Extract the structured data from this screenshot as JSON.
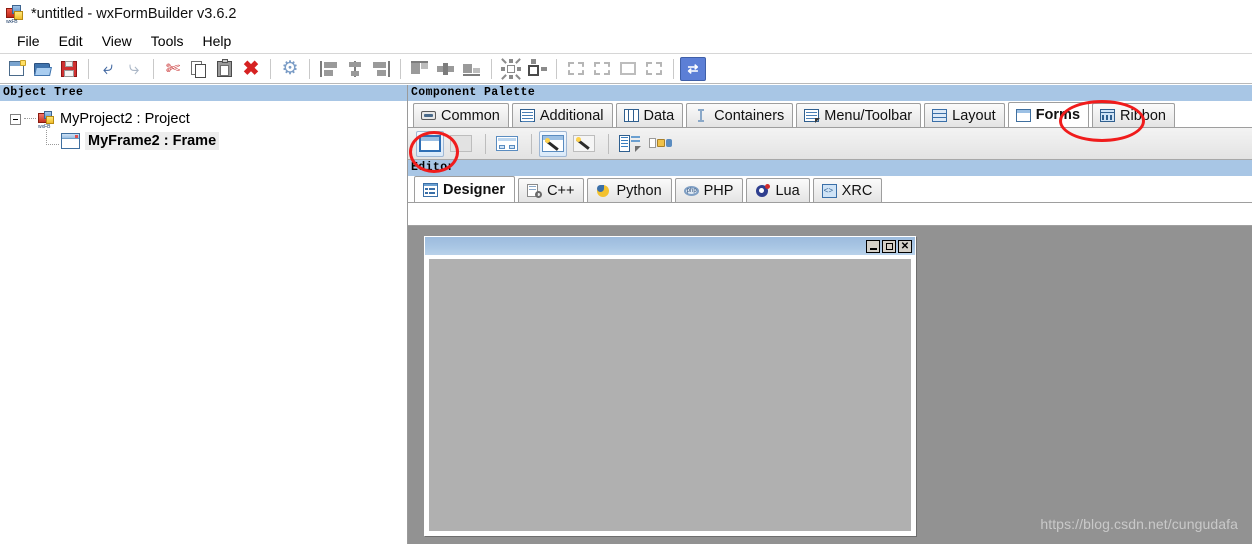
{
  "window": {
    "title": "*untitled - wxFormBuilder v3.6.2",
    "app_icon": "wxformbuilder-icon"
  },
  "menubar": {
    "items": [
      {
        "label": "File"
      },
      {
        "label": "Edit"
      },
      {
        "label": "View"
      },
      {
        "label": "Tools"
      },
      {
        "label": "Help"
      }
    ]
  },
  "toolbar": {
    "buttons": [
      {
        "name": "new-project",
        "icon": "new-file-icon"
      },
      {
        "name": "open-project",
        "icon": "open-folder-icon"
      },
      {
        "name": "save-project",
        "icon": "save-floppy-icon"
      },
      {
        "name": "undo",
        "icon": "undo-arrow-icon"
      },
      {
        "name": "redo",
        "icon": "redo-arrow-icon"
      },
      {
        "name": "cut",
        "icon": "scissors-icon"
      },
      {
        "name": "copy",
        "icon": "copy-icon"
      },
      {
        "name": "paste",
        "icon": "paste-icon"
      },
      {
        "name": "delete",
        "icon": "delete-x-icon"
      },
      {
        "name": "generate-code",
        "icon": "gear-icon"
      },
      {
        "name": "align-left",
        "icon": "align-left-icon"
      },
      {
        "name": "align-center-h",
        "icon": "align-center-icon"
      },
      {
        "name": "align-right",
        "icon": "align-right-icon"
      },
      {
        "name": "align-top",
        "icon": "align-top-icon"
      },
      {
        "name": "align-center-v",
        "icon": "align-middle-icon"
      },
      {
        "name": "align-bottom",
        "icon": "align-bottom-icon"
      },
      {
        "name": "expand",
        "icon": "expand-arrows-icon"
      },
      {
        "name": "stretch",
        "icon": "stretch-icon"
      },
      {
        "name": "border-left",
        "icon": "border-left-icon"
      },
      {
        "name": "border-right",
        "icon": "border-right-icon"
      },
      {
        "name": "border-top",
        "icon": "border-top-icon"
      },
      {
        "name": "border-bottom",
        "icon": "border-bottom-icon"
      },
      {
        "name": "toggle-orientation",
        "icon": "swap-arrows-icon"
      }
    ]
  },
  "object_tree": {
    "caption": "Object Tree",
    "nodes": [
      {
        "label": "MyProject2 : Project",
        "icon": "project-icon",
        "level": 0,
        "expanded": true,
        "selected": false
      },
      {
        "label": "MyFrame2 : Frame",
        "icon": "frame-icon",
        "level": 1,
        "expanded": false,
        "selected": true
      }
    ]
  },
  "component_palette": {
    "caption": "Component Palette",
    "tabs": [
      {
        "label": "Common",
        "icon": "button-icon",
        "selected": false
      },
      {
        "label": "Additional",
        "icon": "list-icon",
        "selected": false
      },
      {
        "label": "Data",
        "icon": "grid-icon",
        "selected": false
      },
      {
        "label": "Containers",
        "icon": "container-icon",
        "selected": false
      },
      {
        "label": "Menu/Toolbar",
        "icon": "menu-icon",
        "selected": false
      },
      {
        "label": "Layout",
        "icon": "layout-icon",
        "selected": false
      },
      {
        "label": "Forms",
        "icon": "form-icon",
        "selected": true
      },
      {
        "label": "Ribbon",
        "icon": "ribbon-icon",
        "selected": false
      }
    ],
    "items": [
      {
        "name": "wx-frame",
        "icon": "frame-widget-icon",
        "selected": true
      },
      {
        "name": "wx-panel-form",
        "icon": "panel-widget-icon",
        "selected": false
      },
      {
        "name": "wx-dialog",
        "icon": "dialog-widget-icon",
        "selected": false
      },
      {
        "name": "wx-wizard",
        "icon": "wizard-icon",
        "selected": false
      },
      {
        "name": "wx-wizard-page",
        "icon": "wizard-page-icon",
        "selected": false
      },
      {
        "name": "wx-menu-bar-form",
        "icon": "menubar-form-icon",
        "selected": false
      },
      {
        "name": "wx-tool-bar-form",
        "icon": "toolbar-form-icon",
        "selected": false
      }
    ]
  },
  "editor": {
    "caption": "Editor",
    "tabs": [
      {
        "label": "Designer",
        "icon": "designer-icon",
        "selected": true
      },
      {
        "label": "C++",
        "icon": "cpp-icon",
        "selected": false
      },
      {
        "label": "Python",
        "icon": "python-icon",
        "selected": false
      },
      {
        "label": "PHP",
        "icon": "php-icon",
        "selected": false
      },
      {
        "label": "Lua",
        "icon": "lua-icon",
        "selected": false
      },
      {
        "label": "XRC",
        "icon": "xrc-icon",
        "selected": false
      }
    ]
  },
  "designer": {
    "form_preview": {
      "title": "",
      "window_buttons": [
        {
          "name": "minimize-button",
          "glyph": "_"
        },
        {
          "name": "maximize-button",
          "glyph": "□"
        },
        {
          "name": "close-button",
          "glyph": "✕"
        }
      ]
    }
  },
  "watermark": {
    "text": "https://blog.csdn.net/cungudafa"
  },
  "annotations": [
    {
      "name": "forms-tab-highlight",
      "shape": "ellipse",
      "color": "#f01c1c"
    },
    {
      "name": "frame-widget-highlight",
      "shape": "ellipse",
      "color": "#f01c1c"
    }
  ],
  "colors": {
    "caption_bar": "#a8c6e5",
    "canvas": "#929292",
    "form_client": "#b0b0b0",
    "annotation_red": "#f01c1c",
    "toggle_blue": "#5c7fd6"
  }
}
